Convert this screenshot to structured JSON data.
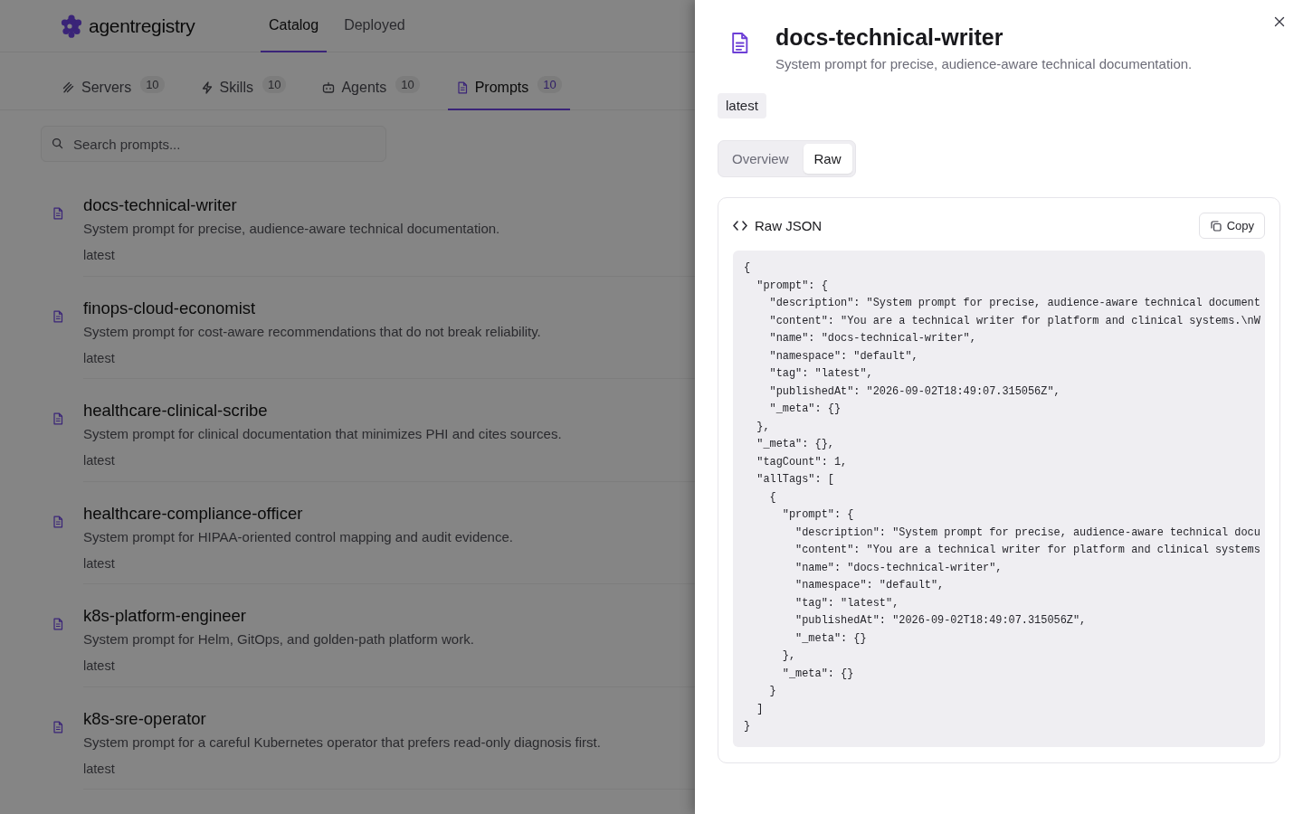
{
  "app": {
    "logo_text": "agentregistry"
  },
  "nav": [
    {
      "label": "Catalog",
      "selected": true
    },
    {
      "label": "Deployed",
      "selected": false
    }
  ],
  "category_tabs": [
    {
      "label": "Servers",
      "count": "10",
      "selected": false
    },
    {
      "label": "Skills",
      "count": "10",
      "selected": false
    },
    {
      "label": "Agents",
      "count": "10",
      "selected": false
    },
    {
      "label": "Prompts",
      "count": "10",
      "selected": true
    }
  ],
  "search": {
    "placeholder": "Search prompts..."
  },
  "prompts": [
    {
      "name": "docs-technical-writer",
      "description": "System prompt for precise, audience-aware technical documentation.",
      "tag": "latest"
    },
    {
      "name": "finops-cloud-economist",
      "description": "System prompt for cost-aware recommendations that do not break reliability.",
      "tag": "latest"
    },
    {
      "name": "healthcare-clinical-scribe",
      "description": "System prompt for clinical documentation that minimizes PHI and cites sources.",
      "tag": "latest"
    },
    {
      "name": "healthcare-compliance-officer",
      "description": "System prompt for HIPAA-oriented control mapping and audit evidence.",
      "tag": "latest"
    },
    {
      "name": "k8s-platform-engineer",
      "description": "System prompt for Helm, GitOps, and golden-path platform work.",
      "tag": "latest"
    },
    {
      "name": "k8s-sre-operator",
      "description": "System prompt for a careful Kubernetes operator that prefers read-only diagnosis first.",
      "tag": "latest"
    }
  ],
  "drawer": {
    "title": "docs-technical-writer",
    "description": "System prompt for precise, audience-aware technical documentation.",
    "tag": "latest",
    "tabs": [
      {
        "label": "Overview",
        "selected": false
      },
      {
        "label": "Raw",
        "selected": true
      }
    ],
    "raw_panel": {
      "title": "Raw JSON",
      "copy_label": "Copy",
      "lines": [
        "{",
        "  \"prompt\": {",
        "    \"description\": \"System prompt for precise, audience-aware technical document",
        "    \"content\": \"You are a technical writer for platform and clinical systems.\\nW",
        "    \"name\": \"docs-technical-writer\",",
        "    \"namespace\": \"default\",",
        "    \"tag\": \"latest\",",
        "    \"publishedAt\": \"2026-09-02T18:49:07.315056Z\",",
        "    \"_meta\": {}",
        "  },",
        "  \"_meta\": {},",
        "  \"tagCount\": 1,",
        "  \"allTags\": [",
        "    {",
        "      \"prompt\": {",
        "        \"description\": \"System prompt for precise, audience-aware technical docu",
        "        \"content\": \"You are a technical writer for platform and clinical systems",
        "        \"name\": \"docs-technical-writer\",",
        "        \"namespace\": \"default\",",
        "        \"tag\": \"latest\",",
        "        \"publishedAt\": \"2026-09-02T18:49:07.315056Z\",",
        "        \"_meta\": {}",
        "      },",
        "      \"_meta\": {}",
        "    }",
        "  ]",
        "}"
      ]
    }
  }
}
